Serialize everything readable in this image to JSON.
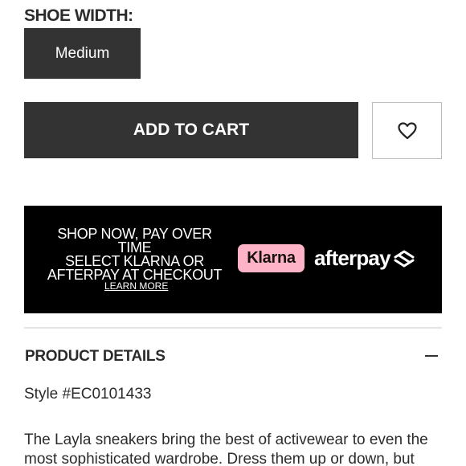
{
  "shoe_width": {
    "label": "SHOE WIDTH:",
    "selected": "Medium"
  },
  "cart": {
    "add_label": "ADD TO CART",
    "wishlist_icon": "heart-icon"
  },
  "promo": {
    "line1": "SHOP NOW, PAY OVER TIME",
    "line2": "SELECT KLARNA OR",
    "line3": "AFTERPAY AT CHECKOUT",
    "learn_more": "LEARN MORE",
    "klarna": "Klarna",
    "afterpay": "afterpay",
    "colors": {
      "banner_bg": "#000000",
      "klarna_bg": "#ffb3c7"
    }
  },
  "details": {
    "heading": "PRODUCT DETAILS",
    "collapse_icon": "minus-icon",
    "style": "Style #EC0101433",
    "description": "The Layla sneakers bring the best of activewear to even the most sophisticated wardrobe. Dress them up or down, but"
  }
}
